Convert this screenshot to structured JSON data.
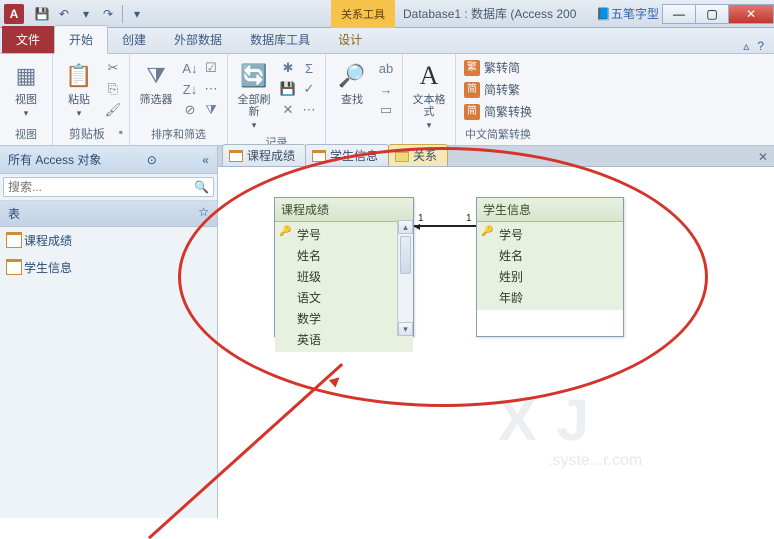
{
  "titlebar": {
    "app_letter": "A",
    "context_group": "关系工具",
    "doc_title": "Database1 : 数据库 (Access 200",
    "ime_label": "五笔字型"
  },
  "tabs": {
    "file": "文件",
    "home": "开始",
    "create": "创建",
    "external": "外部数据",
    "dbtools": "数据库工具",
    "design": "设计"
  },
  "ribbon": {
    "view": {
      "label": "视图"
    },
    "clipboard": {
      "paste": "粘贴",
      "group": "剪贴板"
    },
    "filter": {
      "btn": "筛选器",
      "group": "排序和筛选"
    },
    "records": {
      "refresh": "全部刷新",
      "group": "记录"
    },
    "find": {
      "btn": "查找",
      "group": ""
    },
    "textfmt": {
      "btn": "文本格式",
      "label": "A"
    },
    "cn": {
      "s2t": "繁转简",
      "t2s": "简转繁",
      "conv": "简繁转换",
      "group": "中文简繁转换"
    }
  },
  "nav": {
    "header": "所有 Access 对象",
    "search_placeholder": "搜索...",
    "group_tables": "表",
    "items": [
      "课程成绩",
      "学生信息"
    ]
  },
  "doctabs": {
    "t1": "课程成绩",
    "t2": "学生信息",
    "t3": "关系"
  },
  "tables": {
    "course": {
      "title": "课程成绩",
      "fields": [
        "学号",
        "姓名",
        "班级",
        "语文",
        "数学",
        "英语"
      ]
    },
    "student": {
      "title": "学生信息",
      "fields": [
        "学号",
        "姓名",
        "姓别",
        "年龄"
      ]
    }
  },
  "relation": {
    "left_card": "1",
    "right_card": "1"
  },
  "watermark": {
    "big": "X J",
    "small": ".syste...r.com"
  }
}
